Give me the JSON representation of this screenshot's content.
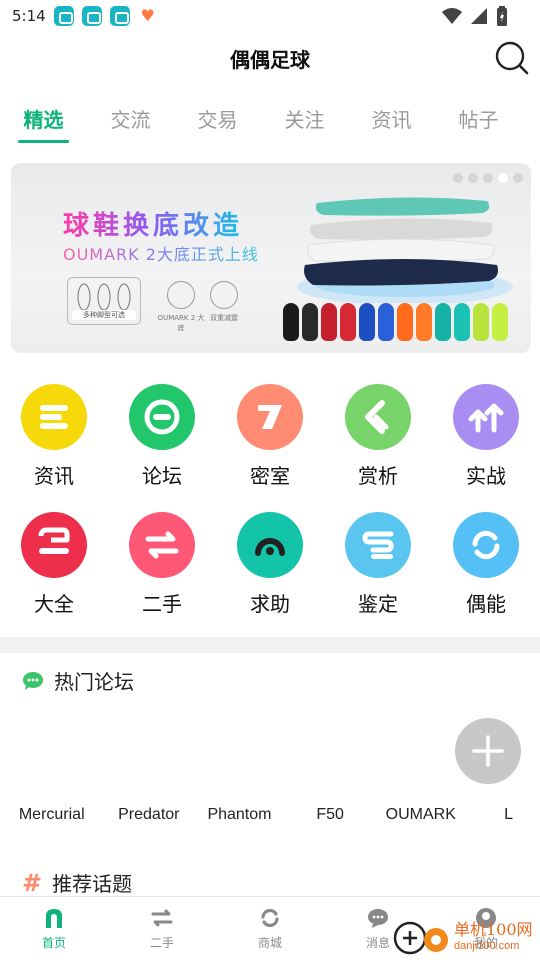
{
  "status_bar": {
    "time": "5:14"
  },
  "header": {
    "title": "偶偶足球"
  },
  "tabs": [
    {
      "label": "精选",
      "active": true
    },
    {
      "label": "交流"
    },
    {
      "label": "交易"
    },
    {
      "label": "关注"
    },
    {
      "label": "资讯"
    },
    {
      "label": "帖子"
    }
  ],
  "banner": {
    "title": "球鞋换底改造",
    "subtitle": "OUMARK 2大底正式上线",
    "box_label": "多种脚型可选",
    "badge1": "OUMARK 2 大底",
    "badge2": "双重减震",
    "slide_count": 5,
    "active_slide": 4
  },
  "grid": [
    {
      "label": "资讯",
      "color": "#f5d90a",
      "icon": "list-icon"
    },
    {
      "label": "论坛",
      "color": "#22c76b",
      "icon": "forum-icon"
    },
    {
      "label": "密室",
      "color": "#ff8b72",
      "icon": "secret-room-icon"
    },
    {
      "label": "赏析",
      "color": "#78d36a",
      "icon": "appreciate-icon"
    },
    {
      "label": "实战",
      "color": "#a98df2",
      "icon": "battle-icon"
    },
    {
      "label": "大全",
      "color": "#ee2f4c",
      "icon": "encyclopedia-icon"
    },
    {
      "label": "二手",
      "color": "#ff5876",
      "icon": "second-hand-icon"
    },
    {
      "label": "求助",
      "color": "#14c4a8",
      "icon": "help-icon"
    },
    {
      "label": "鉴定",
      "color": "#5ac6f0",
      "icon": "authenticate-icon"
    },
    {
      "label": "偶能",
      "color": "#55c0f5",
      "icon": "ouneng-icon"
    }
  ],
  "hot_forums": {
    "title": "热门论坛",
    "items": [
      "Mercurial",
      "Predator",
      "Phantom",
      "F50",
      "OUMARK",
      "L"
    ]
  },
  "topics": {
    "title": "推荐话题"
  },
  "bottom_nav": [
    {
      "label": "首页",
      "active": true,
      "icon": "home-icon"
    },
    {
      "label": "二手",
      "icon": "second-hand-icon"
    },
    {
      "label": "商城",
      "icon": "mall-icon"
    },
    {
      "label": "消息",
      "icon": "message-icon"
    },
    {
      "label": "我的",
      "icon": "profile-icon"
    }
  ],
  "watermark": {
    "text": "单机100网",
    "url": "danji100.com"
  },
  "colors": {
    "accent": "#0db37a",
    "topic_hash": "#ff8a6b"
  }
}
